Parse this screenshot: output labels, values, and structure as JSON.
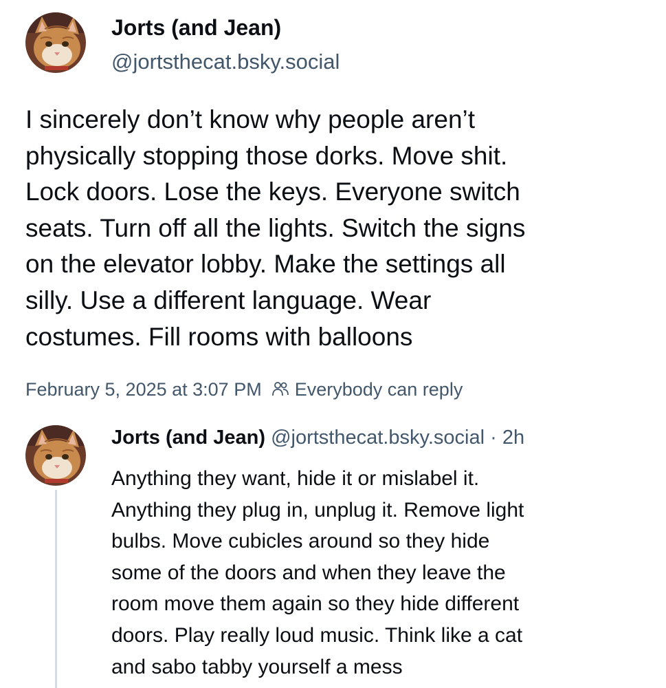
{
  "post": {
    "author": {
      "display_name": "Jorts (and Jean)",
      "handle": "@jortsthecat.bsky.social",
      "avatar": "orange-tabby-cat-photo"
    },
    "text_lines": [
      "I sincerely don’t know why people aren’t",
      "physically stopping those dorks. Move shit.",
      "Lock doors. Lose the keys. Everyone switch",
      "seats. Turn off all the lights. Switch the signs",
      "on the elevator lobby. Make the settings all",
      "silly. Use a different language. Wear",
      "costumes. Fill rooms with balloons"
    ],
    "timestamp": "February 5, 2025 at 3:07 PM",
    "reply_setting_icon": "people-icon",
    "reply_setting": "Everybody can reply"
  },
  "reply": {
    "author": {
      "display_name": "Jorts (and Jean)",
      "handle": "@jortsthecat.bsky.social",
      "avatar": "orange-tabby-cat-photo"
    },
    "separator": " · ",
    "age": "2h",
    "text_lines": [
      "Anything they want, hide it or mislabel it.",
      "Anything they plug in, unplug it. Remove light",
      "bulbs. Move cubicles around so they hide",
      "some of the doors and when they leave the",
      "room move them again so they hide different",
      "doors. Play really loud music. Think like a cat",
      "and sabo tabby yourself a mess"
    ]
  },
  "colors": {
    "text_primary": "#0b0f14",
    "text_secondary": "#42576c",
    "thread_line": "#d4dbe2",
    "background": "#ffffff"
  }
}
